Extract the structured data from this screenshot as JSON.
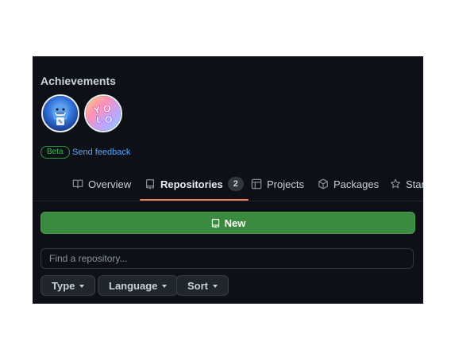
{
  "achievements": {
    "title": "Achievements",
    "badges": [
      {
        "icon": "shark-achievement-icon"
      },
      {
        "icon": "yolo-achievement-icon",
        "text": "YOLO"
      }
    ],
    "beta_label": "Beta",
    "feedback_link": "Send feedback"
  },
  "tabs": [
    {
      "label": "Overview",
      "icon": "book-icon"
    },
    {
      "label": "Repositories",
      "icon": "repo-icon",
      "count": "2",
      "active": true
    },
    {
      "label": "Projects",
      "icon": "table-icon"
    },
    {
      "label": "Packages",
      "icon": "package-icon"
    },
    {
      "label": "Stars",
      "icon": "star-icon"
    }
  ],
  "new_button": {
    "label": "New",
    "icon": "repo-icon"
  },
  "search": {
    "placeholder": "Find a repository..."
  },
  "filters": [
    {
      "label": "Type"
    },
    {
      "label": "Language"
    },
    {
      "label": "Sort"
    }
  ],
  "colors": {
    "background": "#0d1117",
    "accent_underline": "#f78166",
    "primary_button": "#3a8a3f",
    "link": "#58a6ff",
    "beta_green": "#3fb950"
  }
}
